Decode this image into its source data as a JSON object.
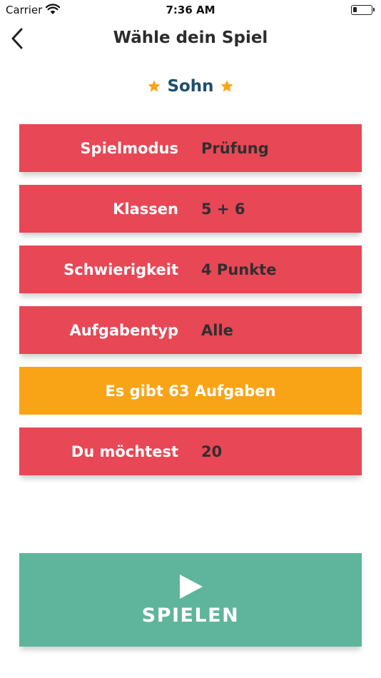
{
  "status_bar": {
    "carrier": "Carrier",
    "time": "7:36 AM"
  },
  "nav": {
    "title": "Wähle dein Spiel"
  },
  "profile": {
    "name": "Sohn"
  },
  "settings": [
    {
      "label": "Spielmodus",
      "value": "Prüfung"
    },
    {
      "label": "Klassen",
      "value": "5 + 6"
    },
    {
      "label": "Schwierigkeit",
      "value": "4 Punkte"
    },
    {
      "label": "Aufgabentyp",
      "value": "Alle"
    }
  ],
  "info": {
    "text": "Es gibt 63 Aufgaben"
  },
  "count_setting": {
    "label": "Du möchtest",
    "value": "20"
  },
  "play": {
    "label": "SPIELEN"
  },
  "colors": {
    "row_red": "#e84755",
    "info_orange": "#f9a416",
    "play_green": "#5fb59b",
    "star_gold": "#f7a51b",
    "profile_blue": "#1f4e6e"
  }
}
